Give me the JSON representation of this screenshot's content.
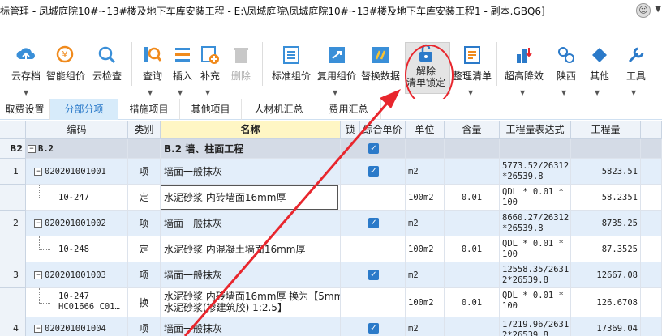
{
  "window": {
    "title": "标管理 - 凤城庭院10#~13#楼及地下车库安装工程 - E:\\凤城庭院\\凤城庭院10#~13#楼及地下车库安装工程1 - 副本.GBQ6]"
  },
  "ribbon": {
    "buttons": [
      {
        "label": "云存档",
        "icon": "cloud-upload-icon",
        "dropdown": true
      },
      {
        "label": "智能组价",
        "icon": "smart-price-icon"
      },
      {
        "label": "云检查",
        "icon": "cloud-check-icon"
      },
      {
        "label": "查询",
        "icon": "query-icon",
        "dropdown": true
      },
      {
        "label": "插入",
        "icon": "insert-icon",
        "dropdown": true
      },
      {
        "label": "补充",
        "icon": "supplement-icon",
        "dropdown": true
      },
      {
        "label": "删除",
        "icon": "delete-icon",
        "disabled": true
      },
      {
        "label": "标准组价",
        "icon": "standard-price-icon"
      },
      {
        "label": "复用组价",
        "icon": "reuse-price-icon",
        "dropdown": true
      },
      {
        "label": "替换数据",
        "icon": "replace-data-icon"
      },
      {
        "label_line1": "解除",
        "label_line2": "清单锁定",
        "icon": "unlock-icon"
      },
      {
        "label": "整理清单",
        "icon": "organize-list-icon",
        "dropdown": true
      },
      {
        "label": "超高降效",
        "icon": "height-reduction-icon",
        "dropdown": true
      },
      {
        "label": "陕西",
        "icon": "shaanxi-icon",
        "dropdown": true
      },
      {
        "label": "其他",
        "icon": "other-icon",
        "dropdown": true
      },
      {
        "label": "工具",
        "icon": "tools-icon",
        "dropdown": true
      }
    ]
  },
  "tabs": [
    "取费设置",
    "分部分项",
    "措施项目",
    "其他项目",
    "人材机汇总",
    "费用汇总"
  ],
  "active_tab": "分部分项",
  "columns": {
    "code": "编码",
    "type": "类别",
    "name": "名称",
    "lock": "锁定",
    "comp": "综合单价",
    "unit": "单位",
    "qty": "含量",
    "expr": "工程量表达式",
    "amount": "工程量"
  },
  "rows": [
    {
      "no": "B2",
      "code": "B.2",
      "type": "",
      "name": "B.2  墙、柱面工程",
      "locked": true,
      "unit": "",
      "qty": "",
      "expr1": "",
      "expr2": "",
      "amount": ""
    },
    {
      "no": "1",
      "code": "020201001001",
      "type": "项",
      "name": "墙面一般抹灰",
      "locked": true,
      "unit": "m2",
      "qty": "",
      "expr1": "5773.52/26312",
      "expr2": "*26539.8",
      "amount": "5823.51"
    },
    {
      "no": "",
      "code": "10-247",
      "type": "定",
      "name": "水泥砂浆 内砖墙面16mm厚",
      "locked": false,
      "unit": "100m2",
      "qty": "0.01",
      "expr1": "QDL * 0.01 *",
      "expr2": "100",
      "amount": "58.2351"
    },
    {
      "no": "2",
      "code": "020201001002",
      "type": "项",
      "name": "墙面一般抹灰",
      "locked": true,
      "unit": "m2",
      "qty": "",
      "expr1": "8660.27/26312",
      "expr2": "*26539.8",
      "amount": "8735.25"
    },
    {
      "no": "",
      "code": "10-248",
      "type": "定",
      "name": "水泥砂浆 内混凝土墙面16mm厚",
      "locked": false,
      "unit": "100m2",
      "qty": "0.01",
      "expr1": "QDL * 0.01 *",
      "expr2": "100",
      "amount": "87.3525"
    },
    {
      "no": "3",
      "code": "020201001003",
      "type": "项",
      "name": "墙面一般抹灰",
      "locked": true,
      "unit": "m2",
      "qty": "",
      "expr1": "12558.35/2631",
      "expr2": "2*26539.8",
      "amount": "12667.08"
    },
    {
      "no": "",
      "code": "10-247",
      "code2": "HC01666 C01…",
      "type": "换",
      "name": "水泥砂浆 内砖墙面16mm厚 换为【5mm厚",
      "name2": "水泥砂浆(掺建筑胶) 1:2.5】",
      "locked": false,
      "unit": "100m2",
      "qty": "0.01",
      "expr1": "QDL * 0.01 *",
      "expr2": "100",
      "amount": "126.6708"
    },
    {
      "no": "4",
      "code": "020201001004",
      "type": "项",
      "name": "墙面一般抹灰",
      "locked": true,
      "unit": "m2",
      "qty": "",
      "expr1": "17219.96/2631",
      "expr2": "2*26539.8",
      "amount": "17369.04"
    }
  ],
  "colors": {
    "accent": "#2b7ac9",
    "highlight_red": "#e8262d",
    "row_blue": "#e3eefa"
  }
}
